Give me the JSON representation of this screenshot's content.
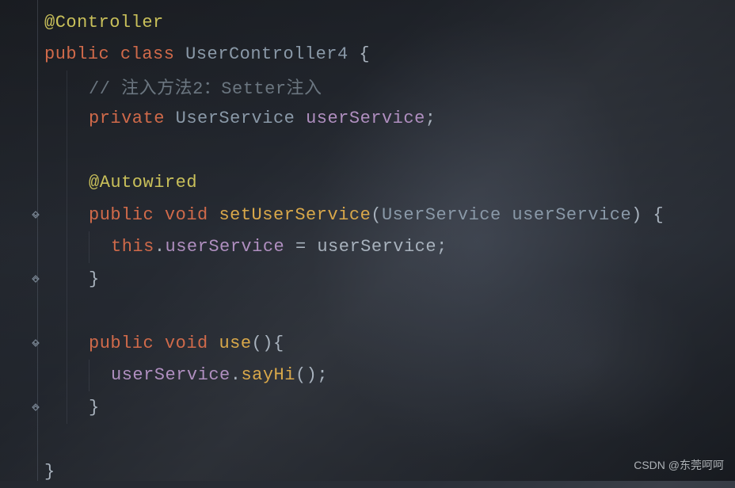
{
  "code": {
    "l1_annotation": "@Controller",
    "l2_pc": "public class ",
    "l2_name": "UserController4",
    "l2_brace": " {",
    "l3_comment": "// 注入方法2：Setter注入",
    "l4_private": "private ",
    "l4_type": "UserService ",
    "l4_field": "userService",
    "l4_semi": ";",
    "l6_annotation": "@Autowired",
    "l7_pv": "public void ",
    "l7_name": "setUserService",
    "l7_open": "(",
    "l7_ptype": "UserService",
    "l7_space": " ",
    "l7_pname": "userService",
    "l7_close": ") {",
    "l8_this": "this",
    "l8_dot": ".",
    "l8_field": "userService",
    "l8_eq": " = ",
    "l8_rhs": "userService",
    "l8_semi": ";",
    "l9_close": "}",
    "l11_pv": "public void ",
    "l11_name": "use",
    "l11_rest": "(){",
    "l12_field": "userService",
    "l12_dot": ".",
    "l12_call": "sayHi",
    "l12_paren": "()",
    "l12_semi": ";",
    "l13_close": "}",
    "l15_close": "}"
  },
  "watermark": "CSDN @东莞呵呵"
}
